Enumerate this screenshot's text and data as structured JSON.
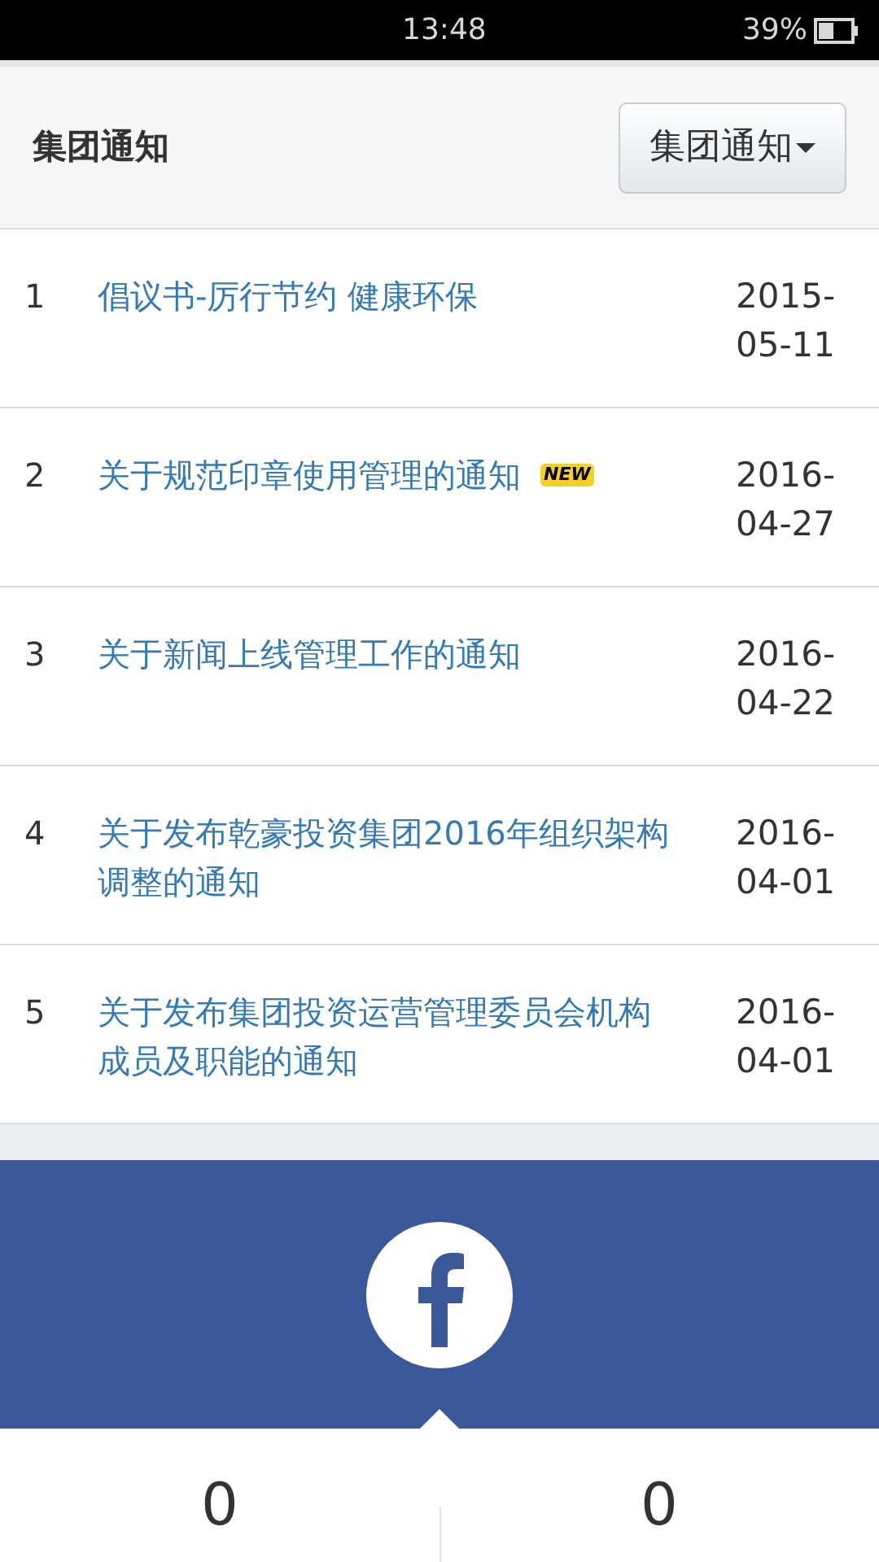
{
  "status_bar": {
    "time": "13:48",
    "battery": "39%"
  },
  "header": {
    "title": "集团通知",
    "dropdown": "集团通知"
  },
  "notices": [
    {
      "index": "1",
      "title": "倡议书-厉行节约 健康环保",
      "date": "2015-05-11"
    },
    {
      "index": "2",
      "title": "关于规范印章使用管理的通知",
      "badge": "NEW",
      "date": "2016-04-27"
    },
    {
      "index": "3",
      "title": "关于新闻上线管理工作的通知",
      "date": "2016-04-22"
    },
    {
      "index": "4",
      "title": "关于发布乾豪投资集团2016年组织架构调整的通知",
      "date": "2016-04-01"
    },
    {
      "index": "5",
      "title": "关于发布集团投资运营管理委员会机构成员及职能的通知",
      "date": "2016-04-01"
    }
  ],
  "stats": [
    {
      "value": "0"
    },
    {
      "value": "0"
    }
  ]
}
